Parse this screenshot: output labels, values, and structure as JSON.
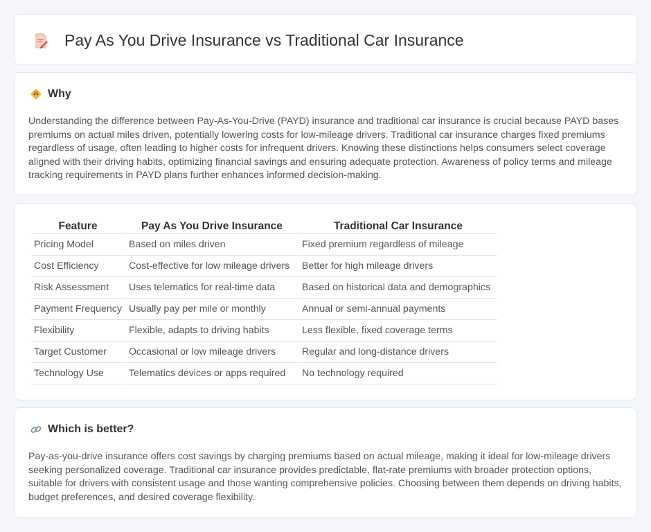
{
  "header": {
    "title": "Pay As You Drive Insurance vs Traditional Car Insurance",
    "icon": "document-pencil-icon"
  },
  "why": {
    "title": "Why",
    "icon": "diamond-warning-icon",
    "text": "Understanding the difference between Pay-As-You-Drive (PAYD) insurance and traditional car insurance is crucial because PAYD bases premiums on actual miles driven, potentially lowering costs for low-mileage drivers. Traditional car insurance charges fixed premiums regardless of usage, often leading to higher costs for infrequent drivers. Knowing these distinctions helps consumers select coverage aligned with their driving habits, optimizing financial savings and ensuring adequate protection. Awareness of policy terms and mileage tracking requirements in PAYD plans further enhances informed decision-making."
  },
  "table": {
    "headers": [
      "Feature",
      "Pay As You Drive Insurance",
      "Traditional Car Insurance"
    ],
    "rows": [
      [
        "Pricing Model",
        "Based on miles driven",
        "Fixed premium regardless of mileage"
      ],
      [
        "Cost Efficiency",
        "Cost-effective for low mileage drivers",
        "Better for high mileage drivers"
      ],
      [
        "Risk Assessment",
        "Uses telematics for real-time data",
        "Based on historical data and demographics"
      ],
      [
        "Payment Frequency",
        "Usually pay per mile or monthly",
        "Annual or semi-annual payments"
      ],
      [
        "Flexibility",
        "Flexible, adapts to driving habits",
        "Less flexible, fixed coverage terms"
      ],
      [
        "Target Customer",
        "Occasional or low mileage drivers",
        "Regular and long-distance drivers"
      ],
      [
        "Technology Use",
        "Telematics devices or apps required",
        "No technology required"
      ]
    ]
  },
  "better": {
    "title": "Which is better?",
    "icon": "link-icon",
    "text": "Pay-as-you-drive insurance offers cost savings by charging premiums based on actual mileage, making it ideal for low-mileage drivers seeking personalized coverage. Traditional car insurance provides predictable, flat-rate premiums with broader protection options, suitable for drivers with consistent usage and those wanting comprehensive policies. Choosing between them depends on driving habits, budget preferences, and desired coverage flexibility."
  }
}
